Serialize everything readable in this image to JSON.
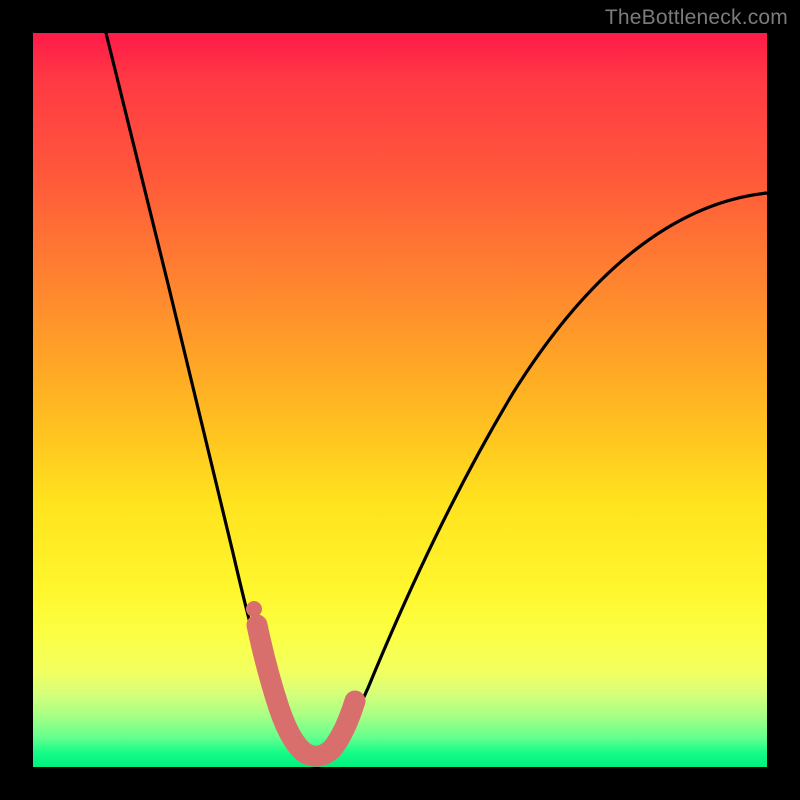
{
  "watermark": {
    "text": "TheBottleneck.com"
  },
  "gradient": {
    "top": "#ff1a49",
    "mid_upper": "#ff8a2e",
    "mid": "#ffe31e",
    "mid_lower": "#fbff44",
    "bottom": "#00f07e"
  },
  "chart_data": {
    "type": "line",
    "title": "",
    "xlabel": "",
    "ylabel": "",
    "xlim": [
      0,
      100
    ],
    "ylim": [
      0,
      100
    ],
    "grid": false,
    "legend": false,
    "notes": "Bottleneck-style V curve. Y reads as percent bottleneck (0 at bottom/green, 100 at top/red). Min of curve sits near x≈37, y≈2. Values estimated from pixel positions against a 0–100 frame.",
    "series": [
      {
        "name": "bottleneck-curve",
        "x": [
          10,
          14,
          18,
          22,
          26,
          29,
          31,
          33,
          35,
          37,
          39,
          41,
          43,
          46,
          50,
          55,
          60,
          66,
          72,
          78,
          85,
          92,
          100
        ],
        "y": [
          100,
          84,
          68,
          52,
          37,
          25,
          17,
          10,
          5,
          2,
          2,
          3,
          5,
          10,
          18,
          28,
          37,
          46,
          54,
          61,
          67,
          73,
          78
        ]
      }
    ],
    "highlight": {
      "name": "optimal-range-marker",
      "color": "#d96f6c",
      "x": [
        30.5,
        31.5,
        33,
        35,
        37,
        39,
        41,
        42.5,
        43.5
      ],
      "y": [
        19,
        14,
        8,
        4,
        2,
        2,
        3,
        5,
        8
      ]
    }
  }
}
